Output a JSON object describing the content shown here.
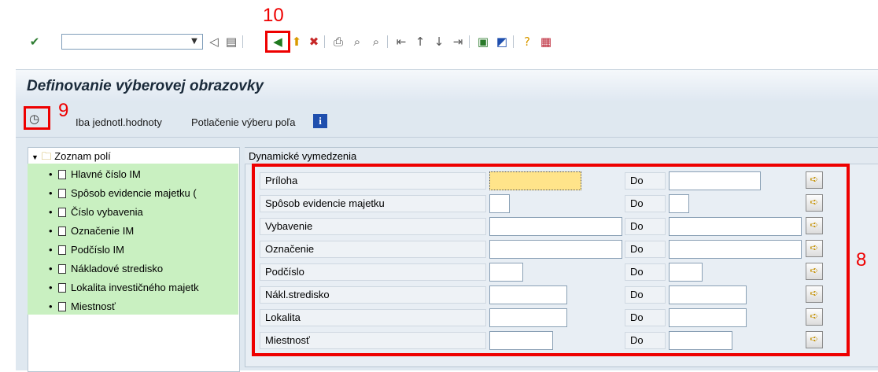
{
  "annotations": {
    "step_8": "8",
    "step_9": "9",
    "step_10": "10"
  },
  "toolbar": {
    "command_field_value": "",
    "icons": [
      "check-icon",
      "dropdown-icon",
      "back-arrow-icon",
      "save-icon",
      "back-green-icon",
      "exit-icon",
      "cancel-icon",
      "print-icon",
      "find-icon",
      "find-next-icon",
      "first-page-icon",
      "prev-page-icon",
      "next-page-icon",
      "last-page-icon",
      "new-session-icon",
      "shortcut-icon",
      "help-icon",
      "layout-icon"
    ]
  },
  "title": "Definovanie výberovej obrazovky",
  "app_toolbar": {
    "single_values_label": "Iba jednotl.hodnoty",
    "suppress_label": "Potlačenie výberu poľa",
    "info_icon": "i"
  },
  "tree": {
    "header": "Zoznam polí",
    "items": [
      "Hlavné číslo IM",
      "Spôsob evidencie majetku (",
      "Číslo vybavenia",
      "Označenie IM",
      "Podčíslo IM",
      "Nákladové stredisko",
      "Lokalita investičného majetk",
      "Miestnosť"
    ]
  },
  "dynamic": {
    "title": "Dynamické vymedzenia",
    "to_label": "Do",
    "rows": [
      {
        "label": "Príloha",
        "from": "",
        "to": ""
      },
      {
        "label": "Spôsob evidencie majetku",
        "from": "",
        "to": ""
      },
      {
        "label": "Vybavenie",
        "from": "",
        "to": ""
      },
      {
        "label": "Označenie",
        "from": "",
        "to": ""
      },
      {
        "label": "Podčíslo",
        "from": "",
        "to": ""
      },
      {
        "label": "Nákl.stredisko",
        "from": "",
        "to": ""
      },
      {
        "label": "Lokalita",
        "from": "",
        "to": ""
      },
      {
        "label": "Miestnosť",
        "from": "",
        "to": ""
      }
    ]
  }
}
